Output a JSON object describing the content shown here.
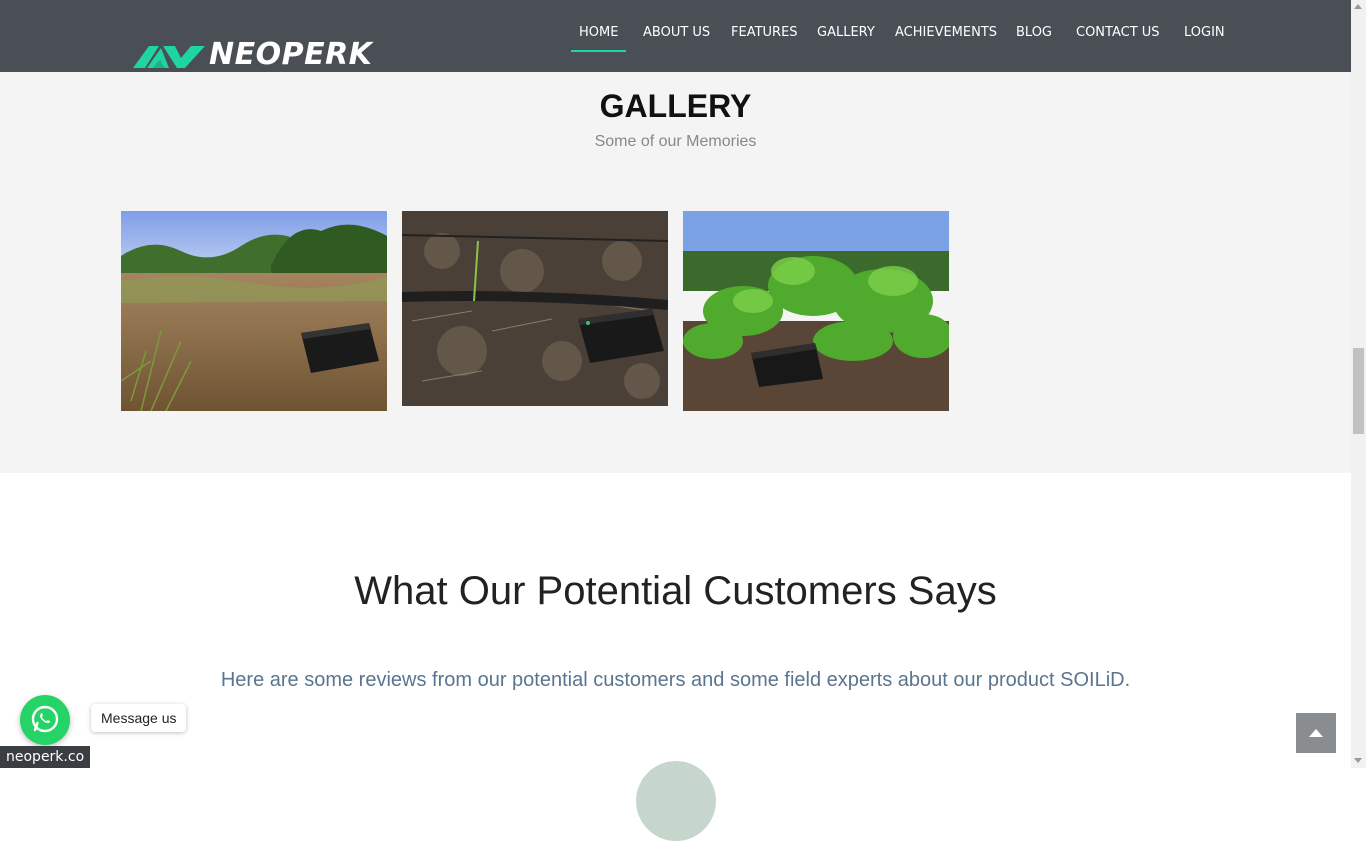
{
  "brand": {
    "name": "NEOPERK"
  },
  "nav": {
    "items": [
      {
        "label": "HOME",
        "active": true
      },
      {
        "label": "ABOUT US"
      },
      {
        "label": "FEATURES"
      },
      {
        "label": "GALLERY"
      },
      {
        "label": "ACHIEVEMENTS"
      },
      {
        "label": "BLOG"
      },
      {
        "label": "CONTACT US"
      },
      {
        "label": "LOGIN"
      }
    ]
  },
  "gallery": {
    "title": "GALLERY",
    "subtitle": "Some of our Memories",
    "photos": [
      {
        "icon": "field-sensor-photo"
      },
      {
        "icon": "irrigation-sensor-photo"
      },
      {
        "icon": "plant-sensor-photo"
      }
    ]
  },
  "reviews": {
    "title": "What Our Potential Customers Says",
    "subtitle": "Here are some reviews from our potential customers and some field experts about our product SOILiD."
  },
  "whatsapp": {
    "label": "Message us",
    "icon": "whatsapp-icon"
  },
  "back_to_top": {
    "icon": "chevron-up-icon"
  },
  "status_url": "neoperk.co",
  "colors": {
    "header": "#4a4f56",
    "accent": "#1fd4a0",
    "whatsapp": "#25d366"
  }
}
